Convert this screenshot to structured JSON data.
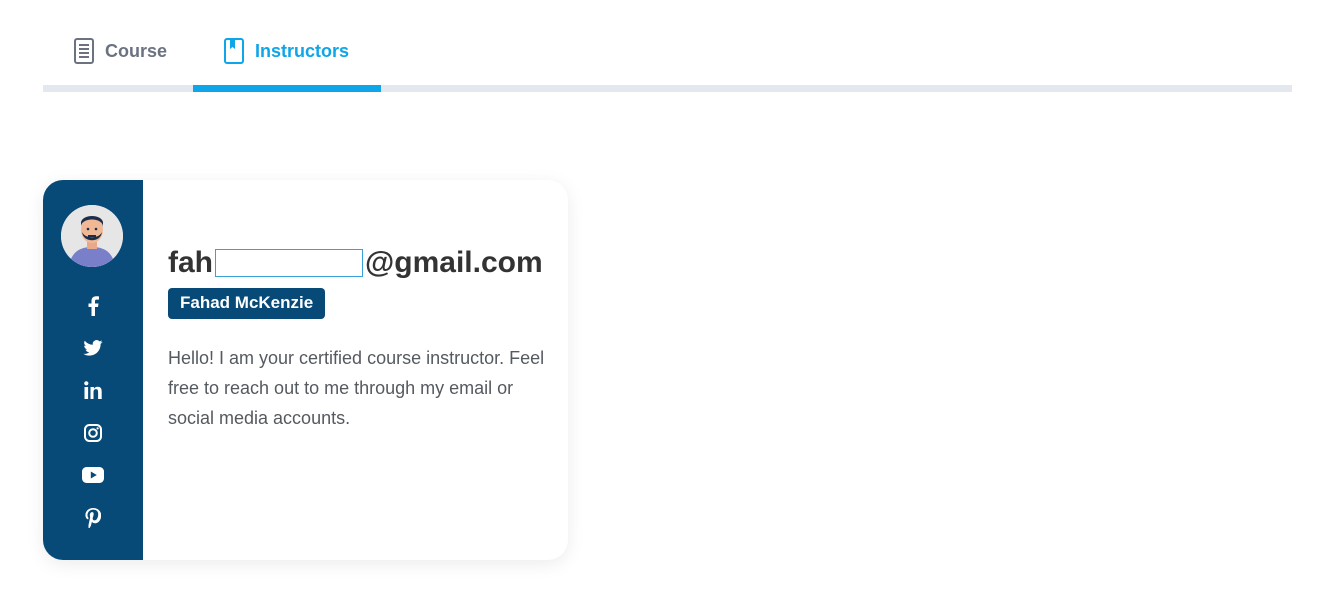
{
  "tabs": [
    {
      "label": "Course",
      "icon": "document-icon",
      "active": false
    },
    {
      "label": "Instructors",
      "icon": "bookmark-book-icon",
      "active": true
    }
  ],
  "colors": {
    "accent": "#0ea5e9",
    "sidebar": "#074a78",
    "text": "#333333",
    "muted": "#6b7280"
  },
  "instructor": {
    "email_prefix": "fah",
    "email_input_value": "",
    "email_suffix": "@gmail.com",
    "name": "Fahad McKenzie",
    "bio": "Hello! I am your certified course instructor. Feel free to reach out to me through my email or social media accounts.",
    "avatar_icon": "avatar",
    "social": [
      {
        "icon": "facebook-icon"
      },
      {
        "icon": "twitter-icon"
      },
      {
        "icon": "linkedin-icon"
      },
      {
        "icon": "instagram-icon"
      },
      {
        "icon": "youtube-icon"
      },
      {
        "icon": "pinterest-icon"
      }
    ]
  }
}
